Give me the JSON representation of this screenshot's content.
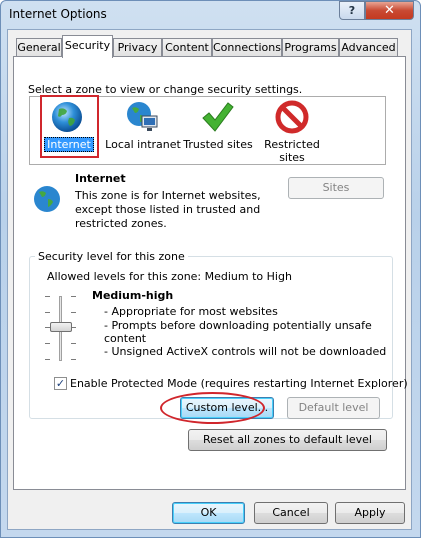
{
  "window": {
    "title": "Internet Options",
    "help_label": "?",
    "close_label": "✕"
  },
  "tabs": [
    {
      "label": "General"
    },
    {
      "label": "Security"
    },
    {
      "label": "Privacy"
    },
    {
      "label": "Content"
    },
    {
      "label": "Connections"
    },
    {
      "label": "Programs"
    },
    {
      "label": "Advanced"
    }
  ],
  "security": {
    "instruction": "Select a zone to view or change security settings.",
    "zones": [
      {
        "label": "Internet",
        "icon": "globe-icon",
        "selected": true
      },
      {
        "label": "Local intranet",
        "icon": "intranet-icon"
      },
      {
        "label": "Trusted sites",
        "icon": "checkmark-icon"
      },
      {
        "label": "Restricted sites",
        "icon": "restricted-icon"
      }
    ],
    "zone_info": {
      "title": "Internet",
      "line1": "This zone is for Internet websites,",
      "line2": "except those listed in trusted and",
      "line3": "restricted zones."
    },
    "sites_button": "Sites",
    "level_group_title": "Security level for this zone",
    "allowed_levels": "Allowed levels for this zone: Medium to High",
    "level_name": "Medium-high",
    "level_points": [
      "- Appropriate for most websites",
      "- Prompts before downloading potentially unsafe",
      "content",
      "- Unsigned ActiveX controls will not be downloaded"
    ],
    "protected_mode_label": "Enable Protected Mode (requires restarting Internet Explorer)",
    "protected_mode_checked": true,
    "custom_level_button": "Custom level...",
    "default_level_button": "Default level",
    "reset_all_button": "Reset all zones to default level"
  },
  "footer": {
    "ok": "OK",
    "cancel": "Cancel",
    "apply": "Apply"
  },
  "colors": {
    "highlight_red": "#d0262c",
    "selection_blue": "#3399ff"
  }
}
